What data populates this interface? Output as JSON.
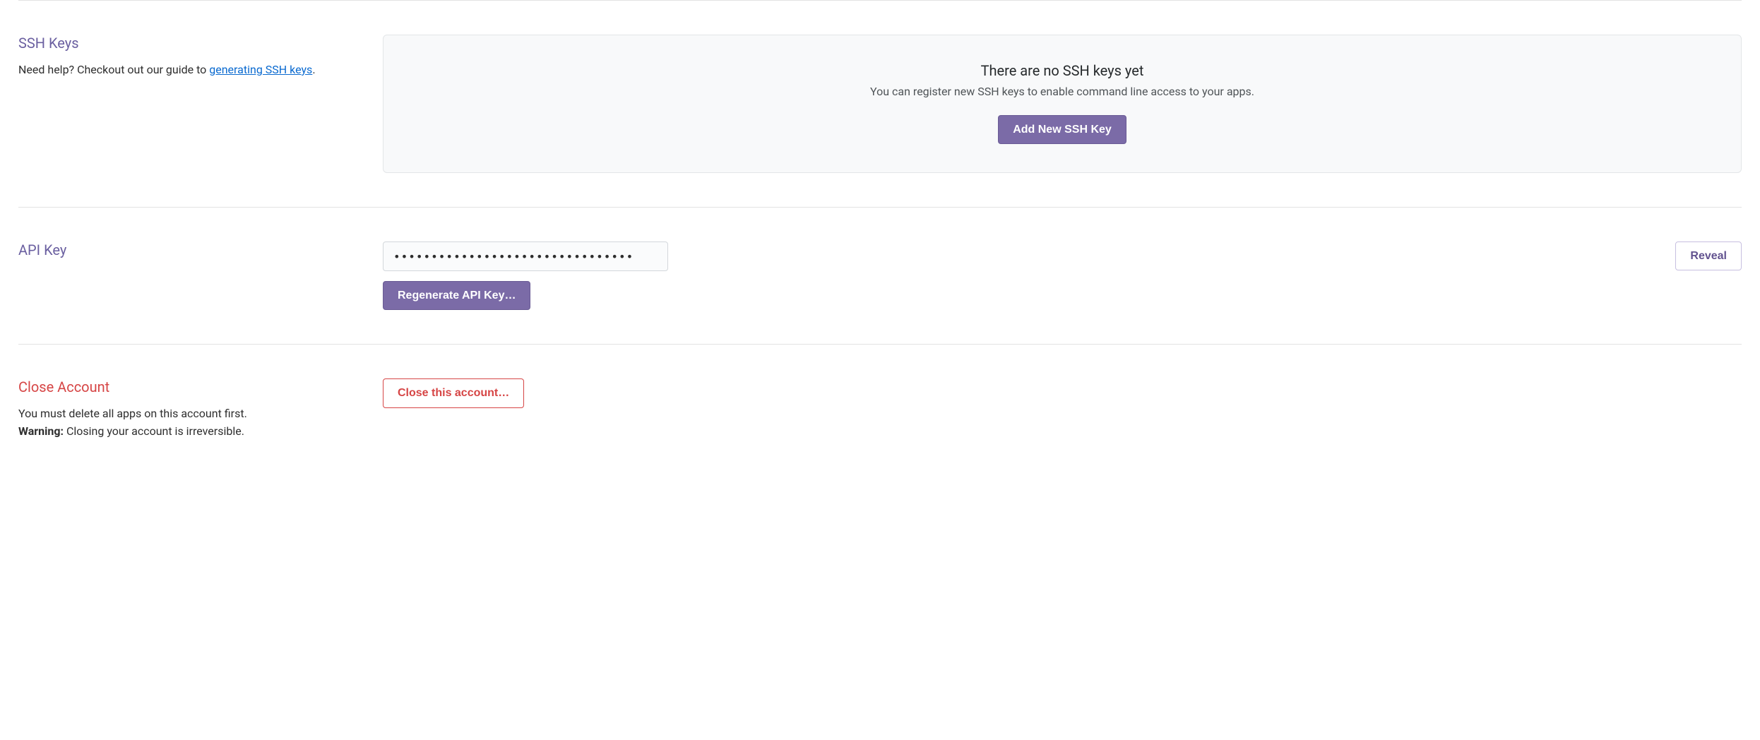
{
  "ssh": {
    "title": "SSH Keys",
    "help_text": "Need help? Checkout out our guide to ",
    "help_link": "generating SSH keys",
    "help_suffix": ".",
    "empty_title": "There are no SSH keys yet",
    "empty_sub": "You can register new SSH keys to enable command line access to your apps.",
    "add_button": "Add New SSH Key"
  },
  "api": {
    "title": "API Key",
    "masked_value": "••••••••••••••••••••••••••••••••",
    "regenerate_button": "Regenerate API Key…",
    "reveal_button": "Reveal"
  },
  "close_account": {
    "title": "Close Account",
    "desc": "You must delete all apps on this account first.",
    "warning_label": "Warning:",
    "warning_text": " Closing your account is irreversible.",
    "button": "Close this account…"
  }
}
